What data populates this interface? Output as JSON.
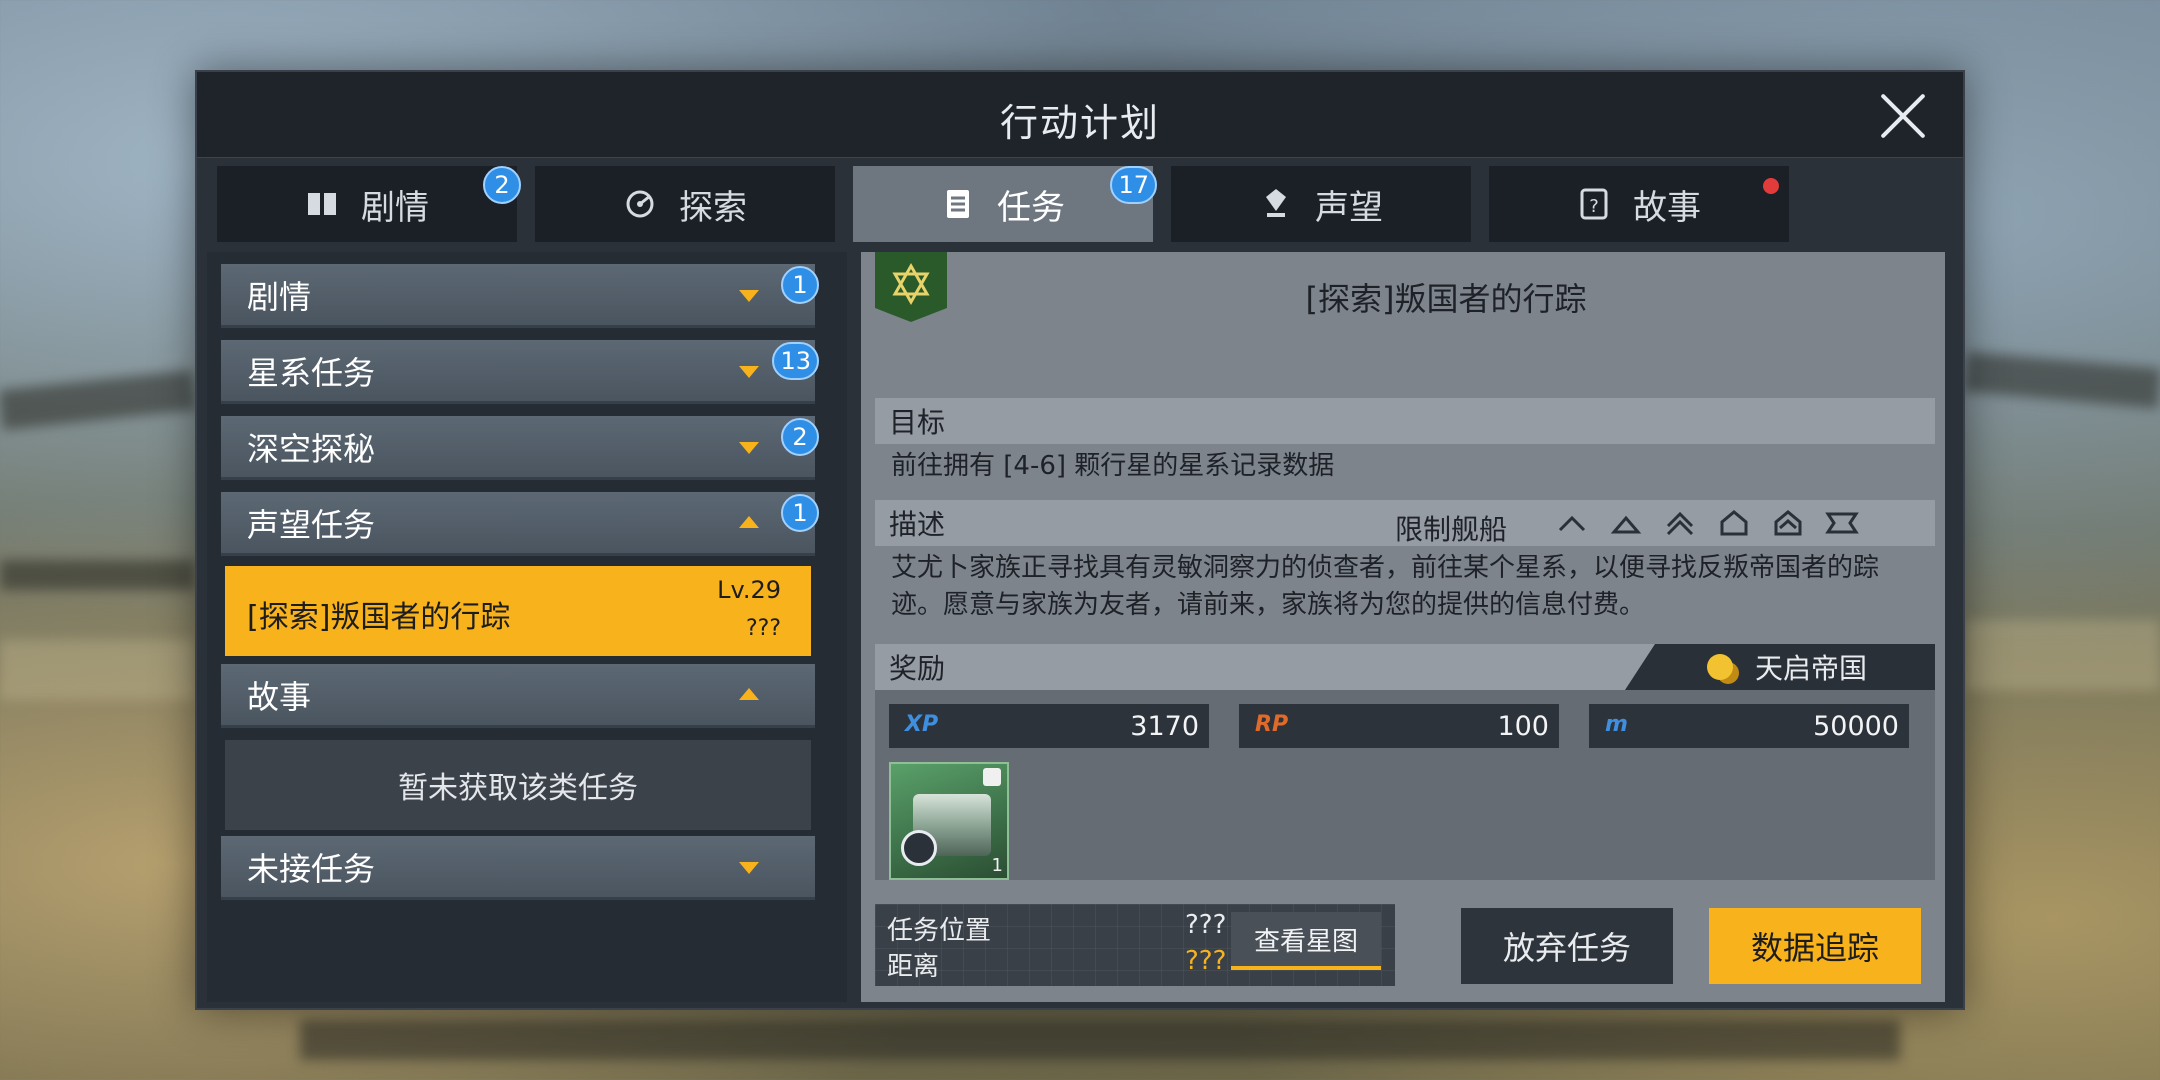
{
  "title": "行动计划",
  "tabs": [
    {
      "label": "剧情",
      "icon": "book-icon",
      "badge": "2"
    },
    {
      "label": "探索",
      "icon": "radar-icon",
      "badge": ""
    },
    {
      "label": "任务",
      "icon": "clipboard-icon",
      "badge": "17",
      "active": true
    },
    {
      "label": "声望",
      "icon": "medal-icon",
      "badge": ""
    },
    {
      "label": "故事",
      "icon": "question-tablet-icon",
      "badge": "",
      "dot": true
    }
  ],
  "categories": {
    "plot": {
      "label": "剧情",
      "badge": "1"
    },
    "galaxy": {
      "label": "星系任务",
      "badge": "13"
    },
    "deepspace": {
      "label": "深空探秘",
      "badge": "2"
    },
    "reputation": {
      "label": "声望任务",
      "badge": "1"
    },
    "story": {
      "label": "故事"
    },
    "unaccepted": {
      "label": "未接任务"
    }
  },
  "selected_quest": {
    "name": "[探索]叛国者的行踪",
    "level": "Lv.29",
    "sub": "???"
  },
  "story_empty": "暂未获取该类任务",
  "detail": {
    "title": "[探索]叛国者的行踪",
    "goal_label": "目标",
    "goal_text": "前往拥有 [4-6] 颗行星的星系记录数据",
    "desc_label": "描述",
    "ship_limit_label": "限制舰船",
    "desc_text": "艾尤卜家族正寻找具有灵敏洞察力的侦查者，前往某个星系，以便寻找反叛帝国者的踪迹。愿意与家族为友者，请前来，家族将为您的提供的信息付费。",
    "reward_label": "奖励",
    "faction": "天启帝国",
    "rewards": [
      {
        "label": "XP",
        "value": "3170",
        "color": "#3f8fe0"
      },
      {
        "label": "RP",
        "value": "100",
        "color": "#e06a2a"
      },
      {
        "label": "m",
        "value": "50000",
        "color": "#3f8fe0"
      }
    ],
    "item_count": "1"
  },
  "location": {
    "pos_label": "任务位置",
    "dist_label": "距离",
    "pos_value": "???",
    "dist_value": "???",
    "starmap_button": "查看星图"
  },
  "buttons": {
    "abandon": "放弃任务",
    "track": "数据追踪"
  }
}
